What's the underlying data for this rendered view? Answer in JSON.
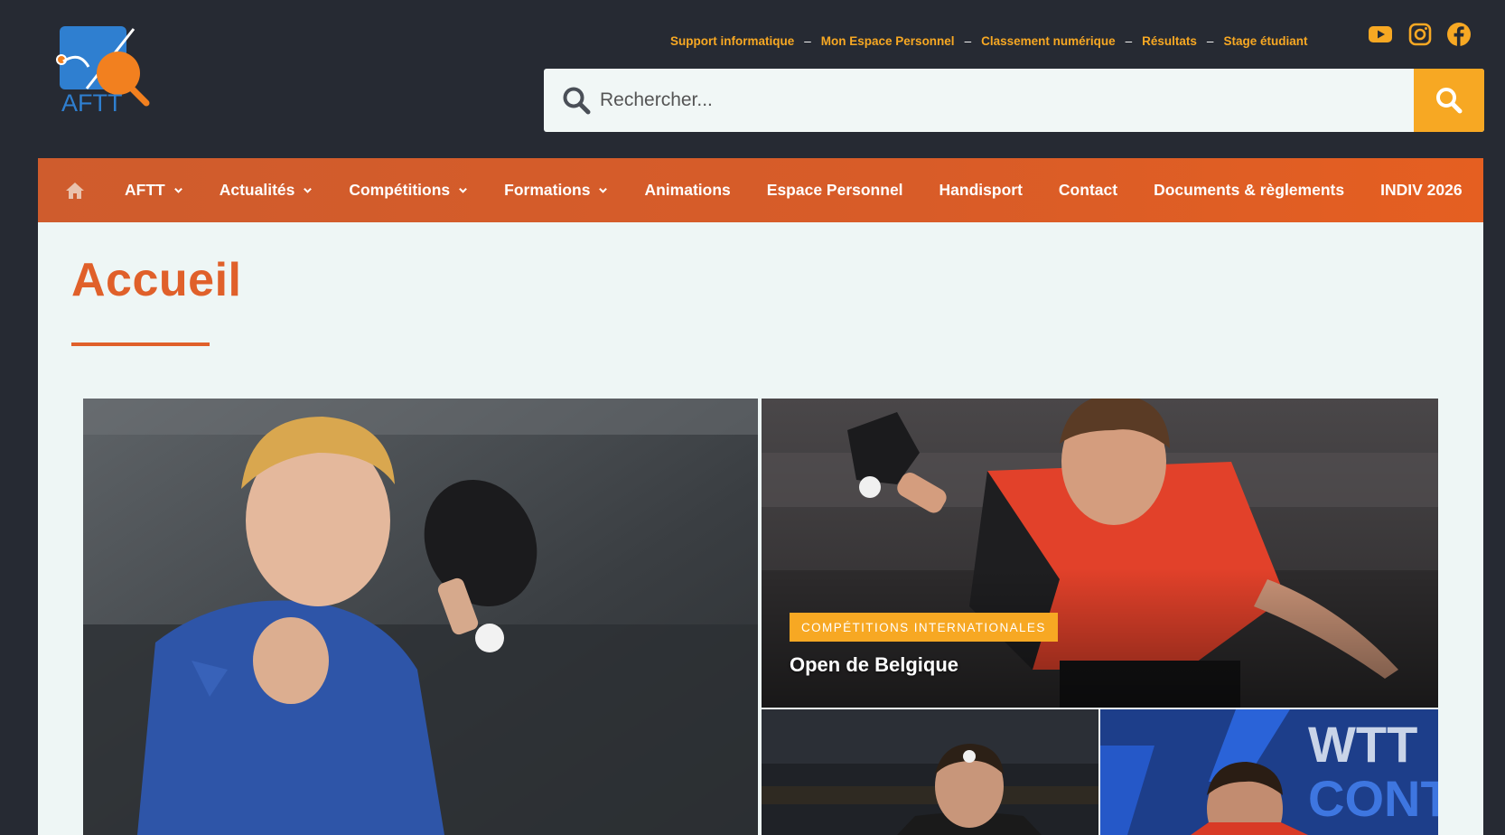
{
  "logo": {
    "text": "AFTT",
    "icon": "aftt-logo"
  },
  "top_links": [
    "Support informatique",
    "Mon Espace Personnel",
    "Classement numérique",
    "Résultats",
    "Stage étudiant"
  ],
  "top_link_separator": "–",
  "social": [
    "youtube-icon",
    "instagram-icon",
    "facebook-icon"
  ],
  "search": {
    "placeholder": "Rechercher..."
  },
  "nav": {
    "home_icon": "home-icon",
    "items": [
      {
        "label": "AFTT",
        "dropdown": true
      },
      {
        "label": "Actualités",
        "dropdown": true
      },
      {
        "label": "Compétitions",
        "dropdown": true
      },
      {
        "label": "Formations",
        "dropdown": true
      },
      {
        "label": "Animations",
        "dropdown": false
      },
      {
        "label": "Espace Personnel",
        "dropdown": false
      },
      {
        "label": "Handisport",
        "dropdown": false
      },
      {
        "label": "Contact",
        "dropdown": false
      },
      {
        "label": "Documents & règlements",
        "dropdown": false
      },
      {
        "label": "INDIV 2026",
        "dropdown": false
      }
    ]
  },
  "page": {
    "title": "Accueil"
  },
  "featured": {
    "category": "COMPÉTITIONS INTERNATIONALES",
    "title": "Open de Belgique"
  },
  "colors": {
    "background": "#262a33",
    "accent_orange": "#e0602a",
    "accent_yellow": "#f7a823",
    "content_bg": "#eef6f5"
  }
}
